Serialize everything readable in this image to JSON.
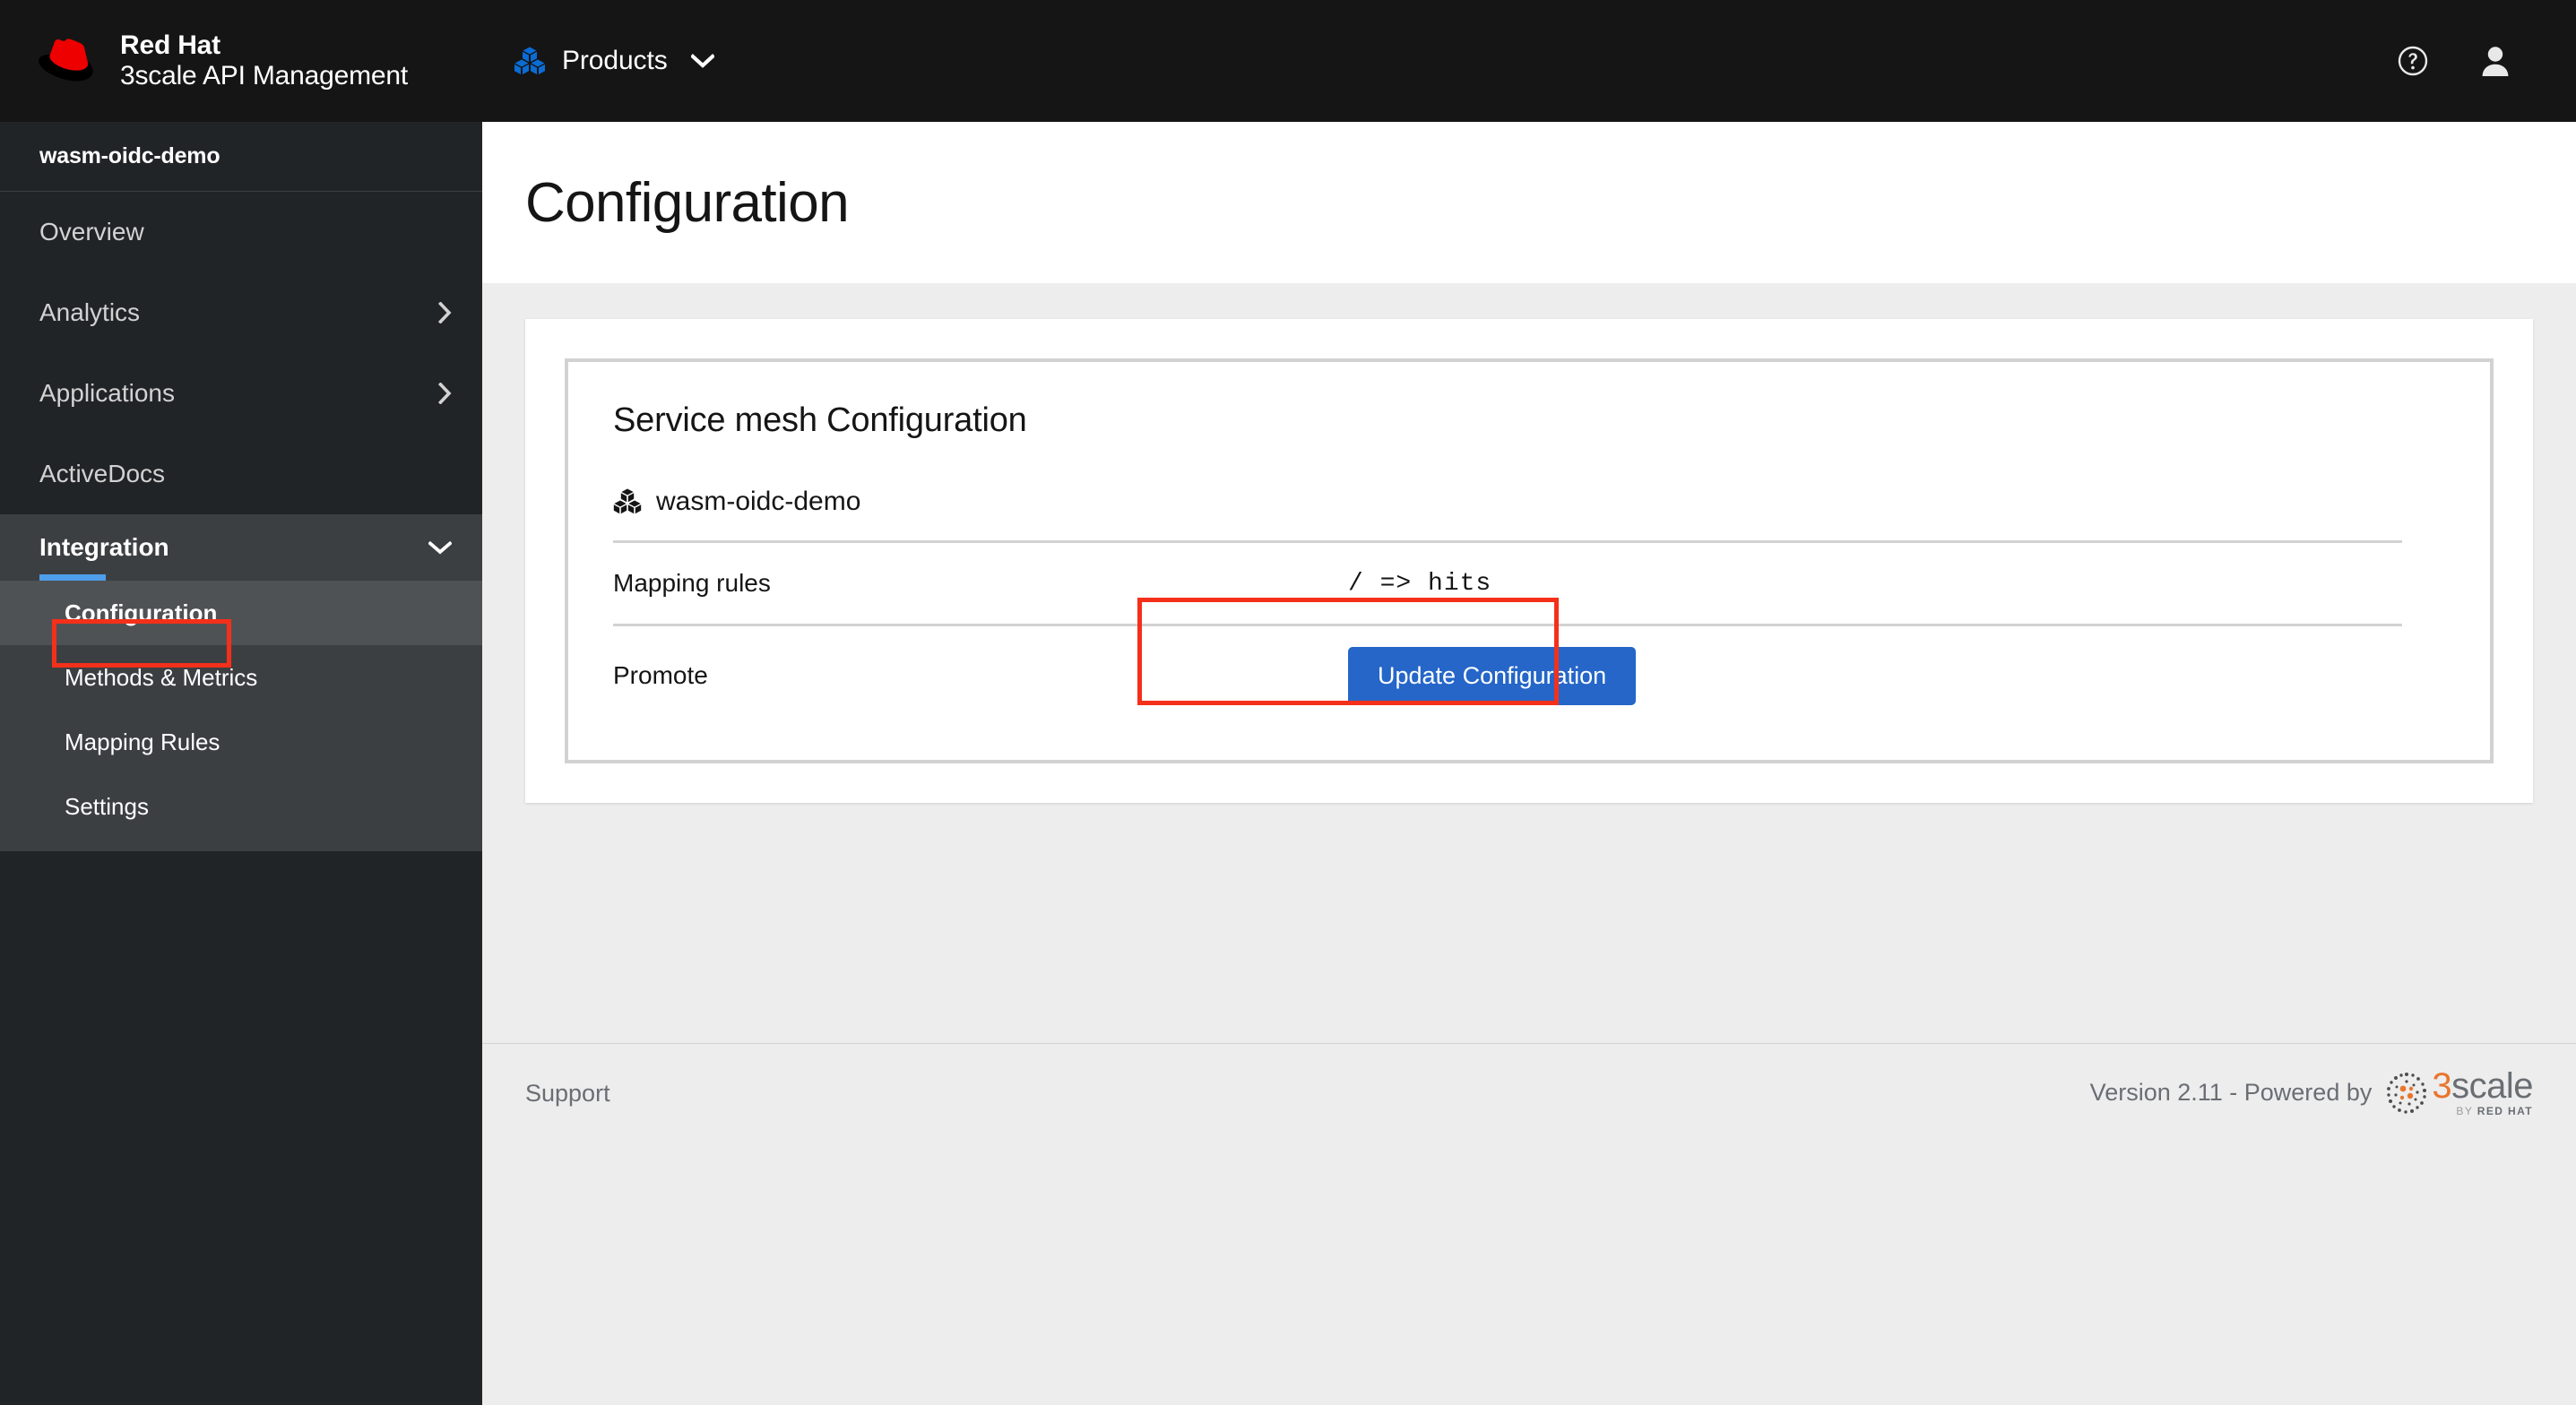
{
  "masthead": {
    "brand_line1": "Red Hat",
    "brand_line2": "3scale API Management",
    "logo_icon": "red-hat-fedora-logo",
    "products_icon": "cubes-icon",
    "products_label": "Products",
    "products_chevron_icon": "chevron-down-icon",
    "help_icon": "help-circle-icon",
    "user_icon": "user-avatar-icon",
    "background_color": "#151515"
  },
  "sidebar": {
    "product_name": "wasm-oidc-demo",
    "background_color": "#212427",
    "items": [
      {
        "label": "Overview",
        "has_chevron": false
      },
      {
        "label": "Analytics",
        "has_chevron": true,
        "chevron_icon": "chevron-right-icon"
      },
      {
        "label": "Applications",
        "has_chevron": true,
        "chevron_icon": "chevron-right-icon"
      },
      {
        "label": "ActiveDocs",
        "has_chevron": false
      }
    ],
    "integration": {
      "label": "Integration",
      "chevron_icon": "chevron-down-icon",
      "expanded": true,
      "accent_color": "#4f9eec",
      "subitems": [
        {
          "label": "Configuration",
          "active": true
        },
        {
          "label": "Methods & Metrics",
          "active": false
        },
        {
          "label": "Mapping Rules",
          "active": false
        },
        {
          "label": "Settings",
          "active": false
        }
      ]
    }
  },
  "main": {
    "page_title": "Configuration",
    "card": {
      "panel_title": "Service mesh Configuration",
      "service_icon": "cubes-icon",
      "service_name": "wasm-oidc-demo",
      "rows": [
        {
          "label": "Mapping rules",
          "value": "/ => hits",
          "value_type": "mono"
        },
        {
          "label": "Promote",
          "value": "",
          "value_type": "button"
        }
      ],
      "update_button_label": "Update Configuration",
      "update_button_color": "#2566c8"
    }
  },
  "footer": {
    "support_label": "Support",
    "version_text": "Version 2.11 - Powered by",
    "logo_3": "3",
    "logo_scale": "scale",
    "logo_by": "BY ",
    "logo_redhat": "RED HAT",
    "logo_dots_icon": "dotted-circle-icon"
  },
  "annotations": {
    "accent_color": "#f4301b",
    "highlight_config_menu": "Configuration",
    "highlight_update_button": "Update Configuration"
  }
}
